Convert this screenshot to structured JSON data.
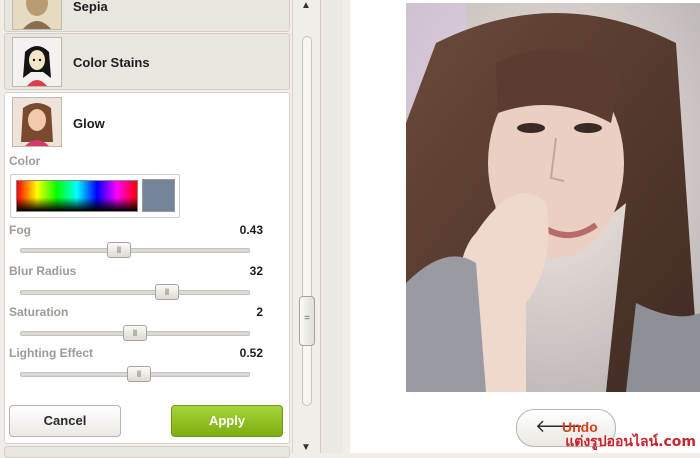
{
  "effects": [
    {
      "label": "Sepia"
    },
    {
      "label": "Color Stains"
    },
    {
      "label": "Glow"
    }
  ],
  "glow_panel": {
    "color_label": "Color",
    "swatch_color": "#75849a",
    "fog": {
      "label": "Fog",
      "value": "0.43",
      "fraction": 0.43
    },
    "blur_radius": {
      "label": "Blur Radius",
      "value": "32",
      "fraction": 0.64
    },
    "saturation": {
      "label": "Saturation",
      "value": "2",
      "fraction": 0.5
    },
    "lighting_effect": {
      "label": "Lighting Effect",
      "value": "0.52",
      "fraction": 0.52
    }
  },
  "buttons": {
    "cancel": "Cancel",
    "apply": "Apply",
    "undo": "Undo"
  },
  "watermark": "แต่งรูปออนไลน์.com",
  "colors": {
    "apply": "#8cbd1c",
    "undo_text": "#d8401f",
    "watermark": "#c8232f"
  }
}
